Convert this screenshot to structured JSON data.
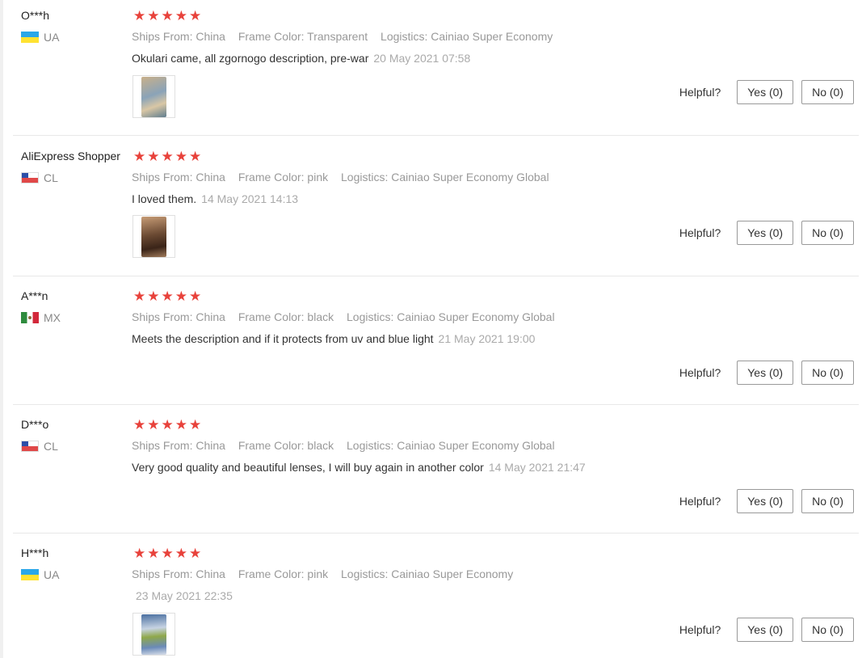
{
  "labels": {
    "ships_from": "Ships From:",
    "frame_color": "Frame Color:",
    "logistics": "Logistics:",
    "helpful": "Helpful?"
  },
  "reviews": [
    {
      "user": "O***h",
      "country": "UA",
      "flag": "ukraine-flag-icon",
      "stars": 5,
      "ships_from": "China",
      "frame_color": "Transparent",
      "logistics": "Cainiao Super Economy",
      "text": "Okulari came, all zgornogo description, pre-war",
      "date": "20 May 2021 07:58",
      "yes": "Yes (0)",
      "no": "No (0)",
      "has_photo": true
    },
    {
      "user": "AliExpress Shopper",
      "country": "CL",
      "flag": "chile-flag-icon",
      "stars": 5,
      "ships_from": "China",
      "frame_color": "pink",
      "logistics": "Cainiao Super Economy Global",
      "text": "I loved them.",
      "date": "14 May 2021 14:13",
      "yes": "Yes (0)",
      "no": "No (0)",
      "has_photo": true
    },
    {
      "user": "A***n",
      "country": "MX",
      "flag": "mexico-flag-icon",
      "stars": 5,
      "ships_from": "China",
      "frame_color": "black",
      "logistics": "Cainiao Super Economy Global",
      "text": "Meets the description and if it protects from uv and blue light",
      "date": "21 May 2021 19:00",
      "yes": "Yes (0)",
      "no": "No (0)",
      "has_photo": false
    },
    {
      "user": "D***o",
      "country": "CL",
      "flag": "chile-flag-icon",
      "stars": 5,
      "ships_from": "China",
      "frame_color": "black",
      "logistics": "Cainiao Super Economy Global",
      "text": "Very good quality and beautiful lenses, I will buy again in another color",
      "date": "14 May 2021 21:47",
      "yes": "Yes (0)",
      "no": "No (0)",
      "has_photo": false
    },
    {
      "user": "H***h",
      "country": "UA",
      "flag": "ukraine-flag-icon",
      "stars": 5,
      "ships_from": "China",
      "frame_color": "pink",
      "logistics": "Cainiao Super Economy",
      "text": "",
      "date": "23 May 2021 22:35",
      "yes": "Yes (0)",
      "no": "No (0)",
      "has_photo": true
    }
  ]
}
